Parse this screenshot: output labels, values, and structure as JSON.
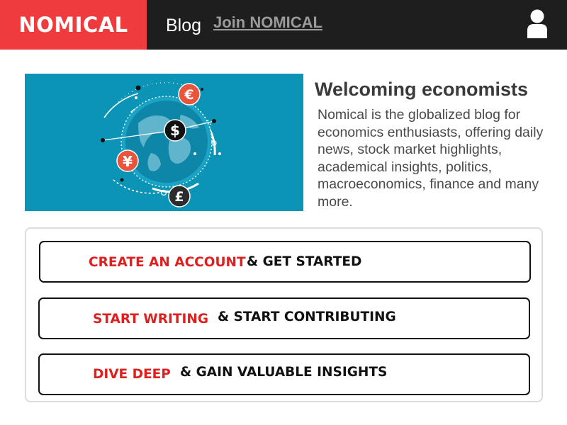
{
  "header": {
    "logo": "NOMICAL",
    "nav": {
      "blog": "Blog",
      "join": "Join NOMICAL"
    },
    "user_icon": "user-icon"
  },
  "hero": {
    "image_icons": [
      "euro-icon",
      "dollar-icon",
      "yen-icon",
      "pound-icon",
      "globe-icon"
    ],
    "currency_symbols": {
      "euro": "€",
      "dollar": "$",
      "yen": "¥",
      "pound": "£"
    },
    "title": "Welcoming economists",
    "description": "Nomical is the globalized blog for economics enthusiasts, offering daily news, stock market highlights, academical insights, politics, macroeconomics, finance and many more."
  },
  "actions": [
    {
      "highlight": "CREATE AN ACCOUNT",
      "rest": "& GET STARTED"
    },
    {
      "highlight": "START WRITING",
      "rest": "& START CONTRIBUTING"
    },
    {
      "highlight": "DIVE DEEP",
      "rest": "& GAIN VALUABLE INSIGHTS"
    }
  ],
  "colors": {
    "brand_red": "#f03b3e",
    "header_bg": "#1e1e1e",
    "hero_bg": "#0b94b5",
    "action_highlight": "#e01f1f",
    "currency_orange": "#e8553c"
  }
}
